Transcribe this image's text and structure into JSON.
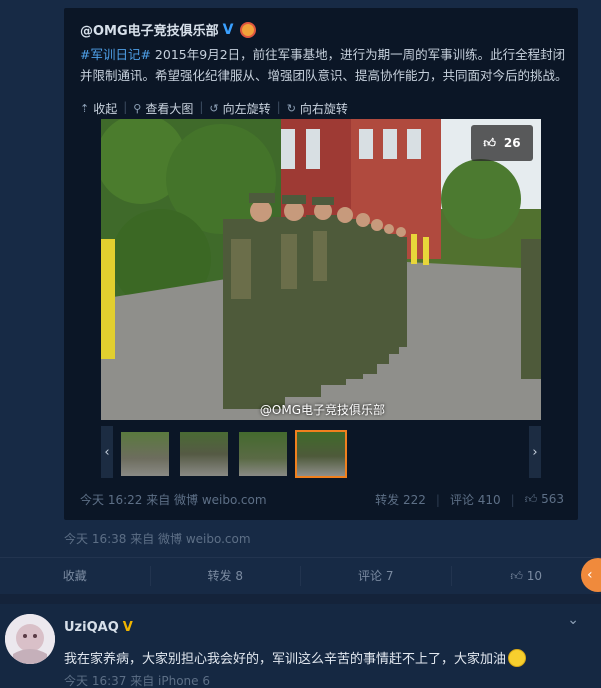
{
  "repost": {
    "author": "@OMG电子竞技俱乐部",
    "hashtag": "#军训日记#",
    "text": " 2015年9月2日，前往军事基地，进行为期一周的军事训练。此行全程封闭并限制通讯。希望强化纪律服从、增强团队意识、提高协作能力，共同面对今后的挑战。",
    "toolbar": {
      "collapse": "收起",
      "view_large": "查看大图",
      "rotate_left": "向左旋转",
      "rotate_right": "向右旋转"
    },
    "photo": {
      "like_count": "26",
      "watermark": "@OMG电子竞技俱乐部"
    },
    "meta": {
      "time_source": "今天 16:22 来自 微博 weibo.com",
      "repost": "转发 222",
      "comment": "评论 410",
      "likes": "563"
    }
  },
  "post_meta": "今天 16:38 来自 微博 weibo.com",
  "actions": {
    "favorite": "收藏",
    "repost": "转发 8",
    "comment": "评论 7",
    "like": "10"
  },
  "comment": {
    "name": "UziQAQ",
    "text": "我在家养病，大家别担心我会好的，军训这么辛苦的事情赶不上了，大家加油",
    "meta": "今天 16:37 来自 iPhone 6"
  },
  "colors": {
    "accent": "#f0801e",
    "link": "#4fa0e8",
    "verified_blue": "#3aa0ff",
    "verified_gold": "#f1b500"
  }
}
